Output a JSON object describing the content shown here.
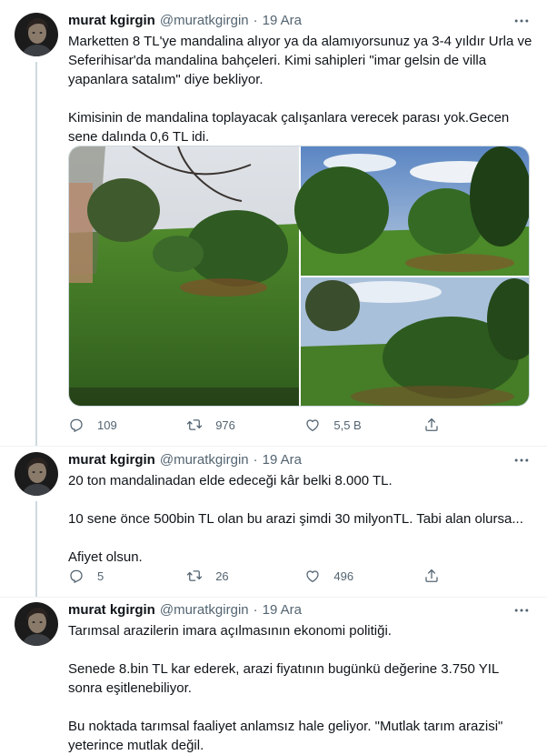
{
  "tweets": [
    {
      "author": {
        "name": "murat kgirgin",
        "handle": "@muratkgirgin",
        "date": "19 Ara"
      },
      "text": "Marketten 8 TL'ye mandalina alıyor ya da alamıyorsunuz ya 3-4 yıldır Urla ve Seferihisar'da mandalina bahçeleri. Kimi sahipleri \"imar gelsin de villa yapanlara satalım\" diye bekliyor.\n\nKimisinin de mandalina toplayacak çalışanlara verecek parası yok.Gecen sene dalında 0,6 TL idi.",
      "stats": {
        "replies": "109",
        "retweets": "976",
        "likes": "5,5 B"
      }
    },
    {
      "author": {
        "name": "murat kgirgin",
        "handle": "@muratkgirgin",
        "date": "19 Ara"
      },
      "text": "20 ton mandalinadan elde edeceği kâr belki 8.000 TL.\n\n10 sene önce 500bin TL olan bu arazi şimdi 30 milyonTL. Tabi alan olursa...\n\nAfiyet olsun.",
      "stats": {
        "replies": "5",
        "retweets": "26",
        "likes": "496"
      }
    },
    {
      "author": {
        "name": "murat kgirgin",
        "handle": "@muratkgirgin",
        "date": "19 Ara"
      },
      "text": "Tarımsal arazilerin imara açılmasının ekonomi politiği.\n\nSenede 8.bin TL kar ederek, arazi fiyatının bugünkü değerine 3.750 YIL sonra eşitlenebiliyor.\n\nBu noktada tarımsal faaliyet anlamsız hale geliyor. \"Mutlak tarım arazisi\" yeterince mutlak değil."
    }
  ],
  "colors": {
    "text": "#0f1419",
    "secondary": "#536471",
    "divider": "#eff3f4",
    "thread": "#cfd9de"
  },
  "icons": [
    "more-icon",
    "reply-icon",
    "retweet-icon",
    "like-icon",
    "share-icon"
  ]
}
